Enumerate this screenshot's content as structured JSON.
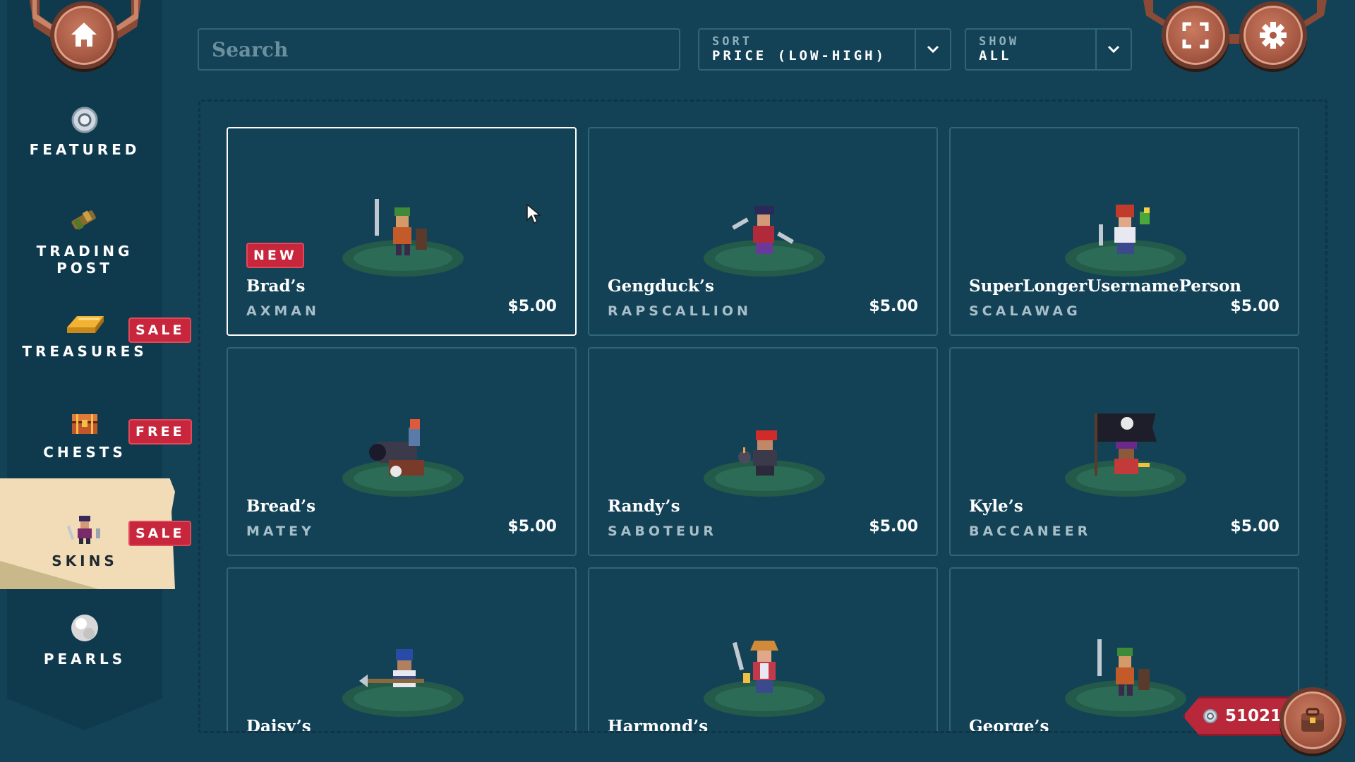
{
  "sidebar": {
    "items": [
      {
        "label": "FEATURED",
        "badge": ""
      },
      {
        "label": "TRADING",
        "label2": "POST",
        "badge": ""
      },
      {
        "label": "TREASURES",
        "badge": "SALE"
      },
      {
        "label": "CHESTS",
        "badge": "FREE"
      },
      {
        "label": "SKINS",
        "badge": "SALE",
        "active": true
      },
      {
        "label": "PEARLS",
        "badge": ""
      }
    ]
  },
  "toolbar": {
    "search_placeholder": "Search",
    "sort_label": "SORT",
    "sort_value": "PRICE (LOW-HIGH)",
    "show_label": "SHOW",
    "show_value": "ALL"
  },
  "cards": [
    {
      "owner": "Brad’s",
      "skin": "AXMAN",
      "price": "$5.00",
      "badge": "NEW",
      "selected": true
    },
    {
      "owner": "Gengduck’s",
      "skin": "RAPSCALLION",
      "price": "$5.00"
    },
    {
      "owner": "SuperLongerUsernamePerson",
      "skin": "SCALAWAG",
      "price": "$5.00"
    },
    {
      "owner": "Bread’s",
      "skin": "MATEY",
      "price": "$5.00"
    },
    {
      "owner": "Randy’s",
      "skin": "SABOTEUR",
      "price": "$5.00"
    },
    {
      "owner": "Kyle’s",
      "skin": "BACCANEER",
      "price": "$5.00"
    },
    {
      "owner": "Daisy’s",
      "skin": "",
      "price": ""
    },
    {
      "owner": "Harmond’s",
      "skin": "",
      "price": ""
    },
    {
      "owner": "George’s",
      "skin": "",
      "price": ""
    }
  ],
  "currency": {
    "amount": "51021"
  },
  "colors": {
    "background": "#134257",
    "sidebar": "#0f3a4e",
    "card_border": "#2f6479",
    "badge_red": "#c7263c",
    "button_copper": "#a85a44",
    "active_tab": "#f2dcb8"
  },
  "icons": {
    "home": "home-icon",
    "fullscreen": "fullscreen-icon",
    "settings": "gear-icon",
    "pearl_coin": "pearl-coin-icon",
    "inventory": "chest-bag-icon"
  }
}
